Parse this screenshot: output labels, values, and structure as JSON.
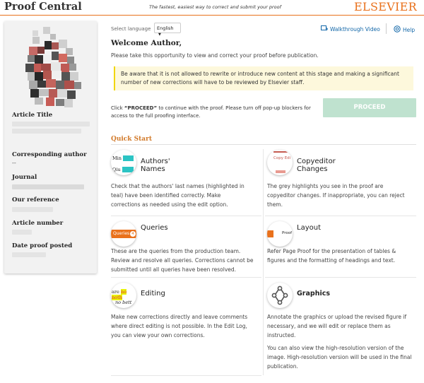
{
  "header": {
    "brand": "Proof Central",
    "tagline": "The fastest, easiest way to correct and submit your proof",
    "logo": "ELSEVIER"
  },
  "sidebar": {
    "fields": [
      {
        "label": "Article Title"
      },
      {
        "label": "Corresponding author",
        "value": "--"
      },
      {
        "label": "Journal"
      },
      {
        "label": "Our reference"
      },
      {
        "label": "Article number"
      },
      {
        "label": "Date proof posted"
      }
    ]
  },
  "toolbar": {
    "language_label": "Select language",
    "language_value": "English",
    "walkthrough": "Walkthrough Video",
    "help": "Help"
  },
  "main": {
    "welcome": "Welcome Author,",
    "intro": "Please take this opportunity to view and correct your proof before publication.",
    "warning": "Be aware that it is not allowed to rewrite or introduce new content at this stage and making a significant number of new corrections will have to be reviewed by Elsevier staff.",
    "click_prefix": "Click ",
    "click_bold": "“PROCEED”",
    "click_suffix": " to continue with the proof. Please turn off pop-up blockers for access to the full proofing interface.",
    "proceed": "PROCEED"
  },
  "quickstart": {
    "title": "Quick Start",
    "cards": [
      {
        "title": "Authors' Names",
        "desc": "Check that the authors' last names (highlighted in teal) have been identified correctly. Make corrections as needed using the edit option.",
        "icon_text_1": "Min",
        "icon_text_2": "Qiu"
      },
      {
        "title": "Copyeditor Changes",
        "desc": "The grey highlights you see in the proof are copyeditor changes. If inappropriate, you can reject them.",
        "icon_text": "Copy Edi"
      },
      {
        "title": "Queries",
        "desc": "These are the queries from the production team. Review and resolve all queries. Corrections cannot be submitted until all queries have been resolved.",
        "icon_text": "Queries",
        "icon_badge": "4"
      },
      {
        "title": "Layout",
        "desc": "Refer Page Proof for the presentation of tables & figures and the formatting of headings and text.",
        "icon_text": "Proof"
      },
      {
        "title": "Editing",
        "desc": "Make new corrections directly and leave comments where direct editing is not possible. In the Edit Log, you can view your own corrections.",
        "icon_text_1": "are",
        "icon_text_2": "no bett"
      },
      {
        "title": "Graphics",
        "desc": "Annotate the graphics or upload the revised figure if necessary, and we will edit or replace them as instructed.",
        "desc2": "You can also view the high-resolution version of the image. High-resolution version will be used in the final publication."
      }
    ]
  },
  "colors": {
    "accent": "#e9711c",
    "proceed_bg": "#bfe2cf",
    "link": "#1166a8",
    "warning_bg": "#fdf8dc",
    "warning_border": "#f1d600",
    "teal_highlight": "#2cc4c4"
  }
}
